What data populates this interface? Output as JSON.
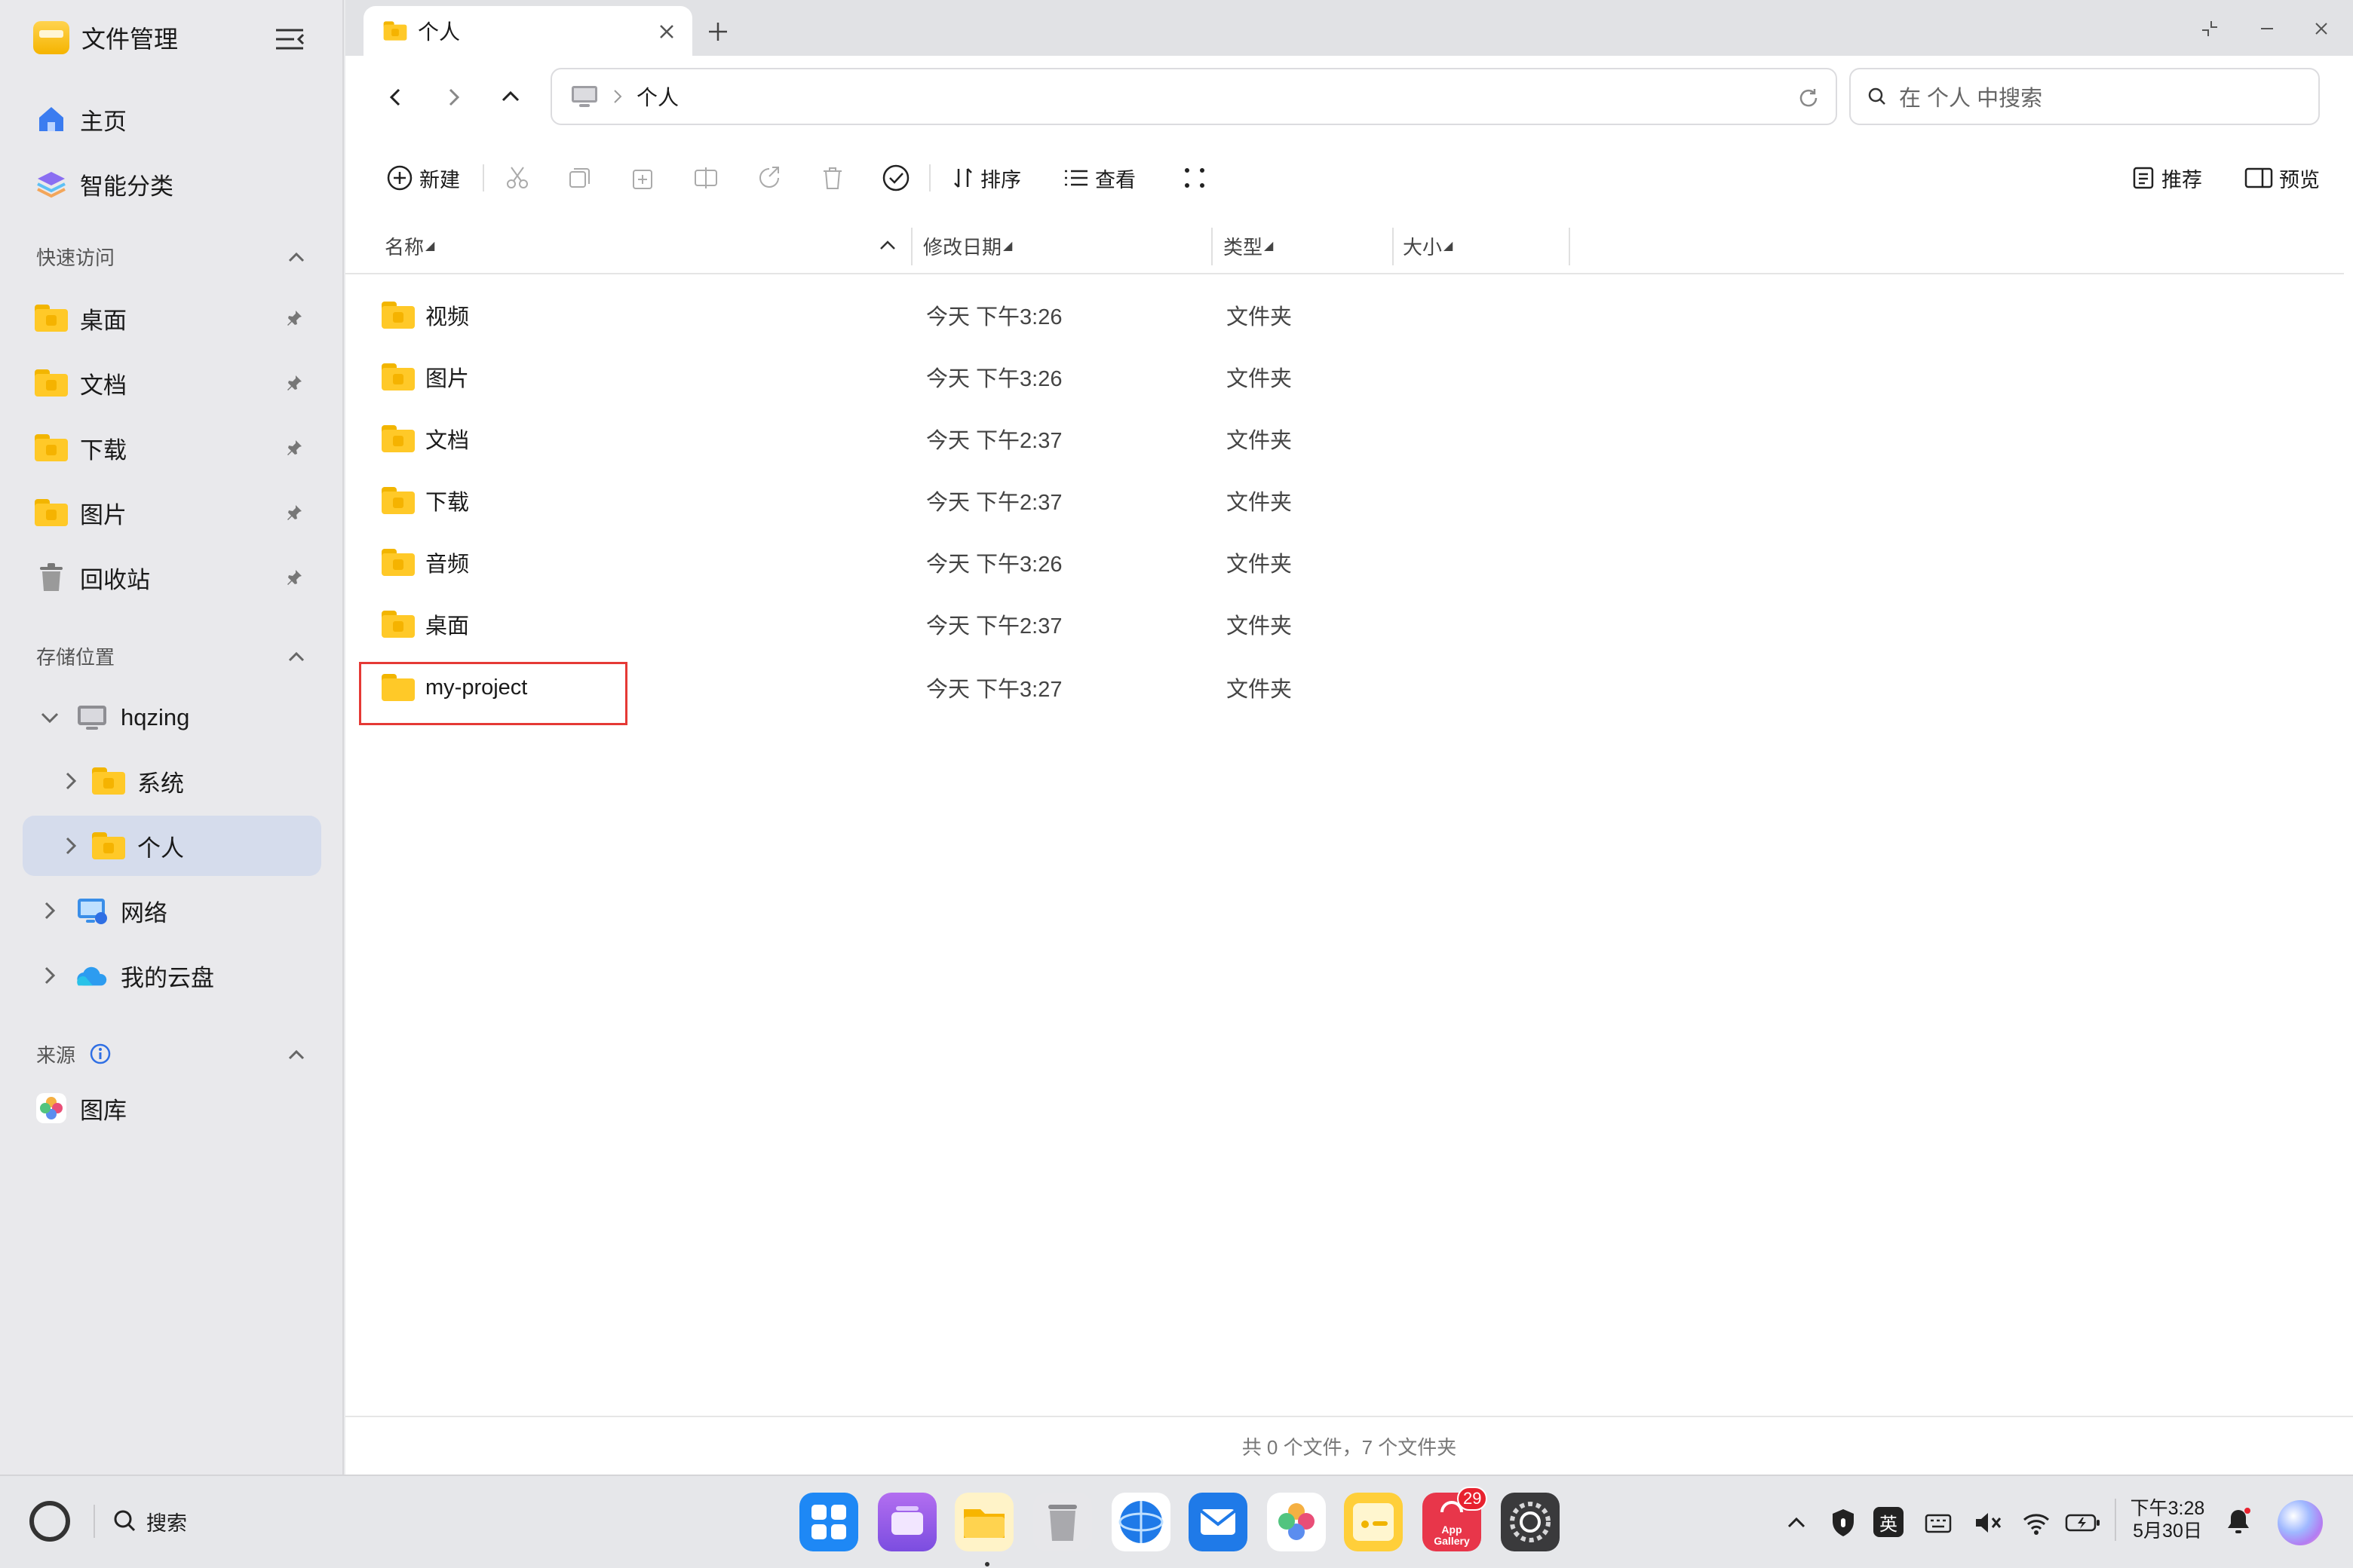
{
  "app": {
    "title": "文件管理"
  },
  "sidebar": {
    "main": [
      {
        "label": "主页"
      },
      {
        "label": "智能分类"
      }
    ],
    "quick_access": {
      "heading": "快速访问",
      "items": [
        {
          "label": "桌面"
        },
        {
          "label": "文档"
        },
        {
          "label": "下载"
        },
        {
          "label": "图片"
        },
        {
          "label": "回收站"
        }
      ]
    },
    "storage": {
      "heading": "存储位置",
      "device": "hqzing",
      "children": [
        {
          "label": "系统"
        },
        {
          "label": "个人"
        }
      ],
      "network": "网络",
      "cloud": "我的云盘"
    },
    "sources": {
      "heading": "来源",
      "items": [
        {
          "label": "图库"
        }
      ]
    }
  },
  "tab": {
    "label": "个人"
  },
  "address": {
    "crumb": "个人"
  },
  "search": {
    "placeholder": "在 个人 中搜索"
  },
  "toolbar": {
    "new_label": "新建",
    "sort_label": "排序",
    "view_label": "查看",
    "recommend_label": "推荐",
    "preview_label": "预览"
  },
  "columns": {
    "name": "名称",
    "date": "修改日期",
    "type": "类型",
    "size": "大小"
  },
  "files": [
    {
      "name": "视频",
      "date": "今天 下午3:26",
      "type": "文件夹",
      "glyph": "video"
    },
    {
      "name": "图片",
      "date": "今天 下午3:26",
      "type": "文件夹",
      "glyph": "image"
    },
    {
      "name": "文档",
      "date": "今天 下午2:37",
      "type": "文件夹",
      "glyph": "doc"
    },
    {
      "name": "下载",
      "date": "今天 下午2:37",
      "type": "文件夹",
      "glyph": "download"
    },
    {
      "name": "音频",
      "date": "今天 下午3:26",
      "type": "文件夹",
      "glyph": "music"
    },
    {
      "name": "桌面",
      "date": "今天 下午2:37",
      "type": "文件夹",
      "glyph": "desktop"
    },
    {
      "name": "my-project",
      "date": "今天 下午3:27",
      "type": "文件夹",
      "glyph": "none"
    }
  ],
  "status": {
    "summary": "共 0 个文件，7 个文件夹"
  },
  "taskbar": {
    "search_label": "搜索",
    "appgallery_badge": "29",
    "appgallery_text": "App Gallery",
    "ime": "英",
    "time": "下午3:28",
    "date": "5月30日"
  },
  "colors": {
    "folder": "#ffc928",
    "selection": "#d5dcec",
    "highlight": "#e53935",
    "accent": "#2f6fe4"
  }
}
